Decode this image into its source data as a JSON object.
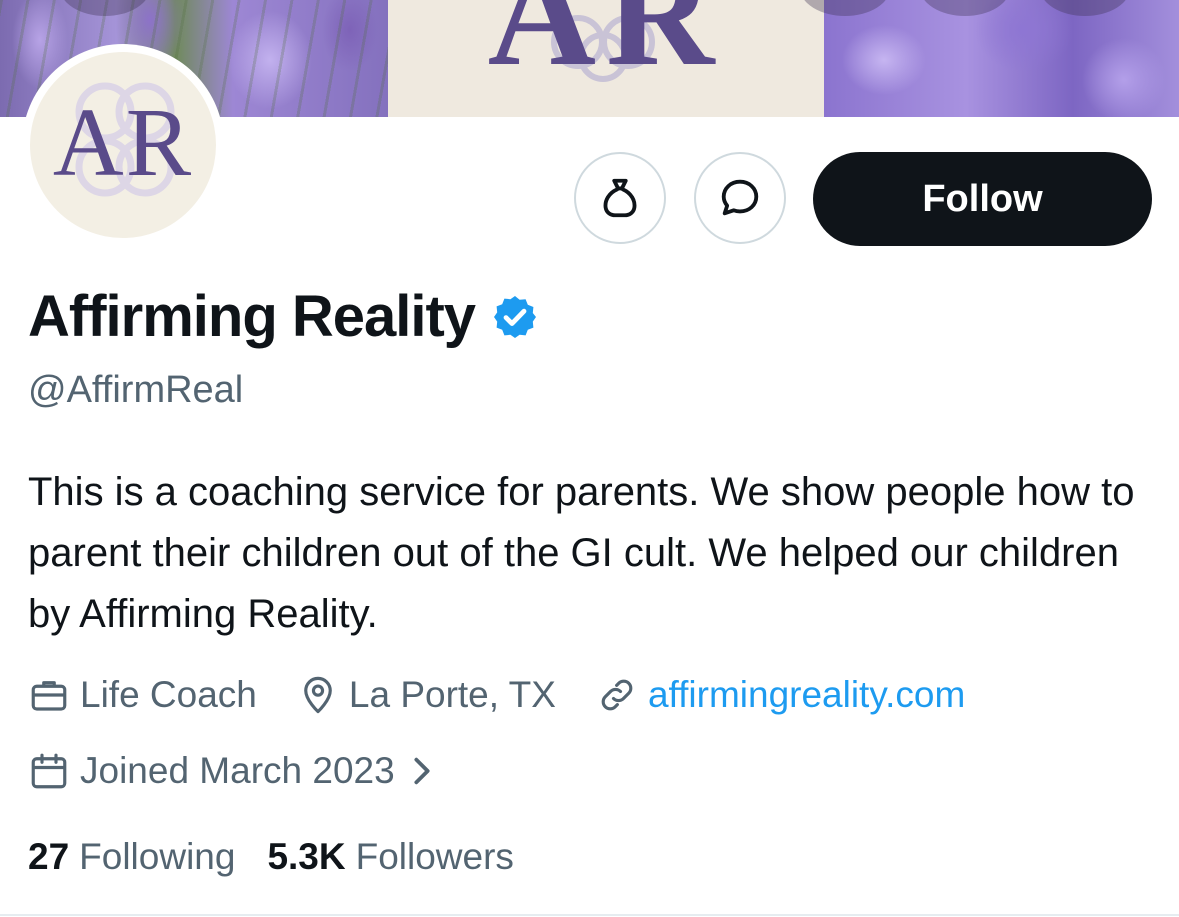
{
  "banner": {
    "text": "AR"
  },
  "avatar": {
    "text": "AR"
  },
  "actions": {
    "follow_label": "Follow"
  },
  "profile": {
    "display_name": "Affirming Reality",
    "handle": "@AffirmReal",
    "bio": "This is a coaching service for parents. We show people how to parent their children out of the GI cult. We helped our children by Affirming Reality.",
    "category": "Life Coach",
    "location": "La Porte, TX",
    "website": "affirmingreality.com",
    "joined": "Joined March 2023"
  },
  "stats": {
    "following_count": "27",
    "following_label": "Following",
    "followers_count": "5.3K",
    "followers_label": "Followers"
  },
  "colors": {
    "text_primary": "#0f1419",
    "text_secondary": "#536471",
    "link": "#1d9bf0",
    "verified_badge": "#1d9bf0",
    "follow_button_bg": "#0f1419",
    "avatar_letters": "#5a4b8a"
  },
  "icons": {
    "tip": "money-bag-icon",
    "message": "message-icon",
    "verified": "verified-badge-icon",
    "category": "briefcase-icon",
    "location": "location-pin-icon",
    "website": "link-icon",
    "joined": "calendar-icon",
    "joined_more": "chevron-right-icon"
  }
}
